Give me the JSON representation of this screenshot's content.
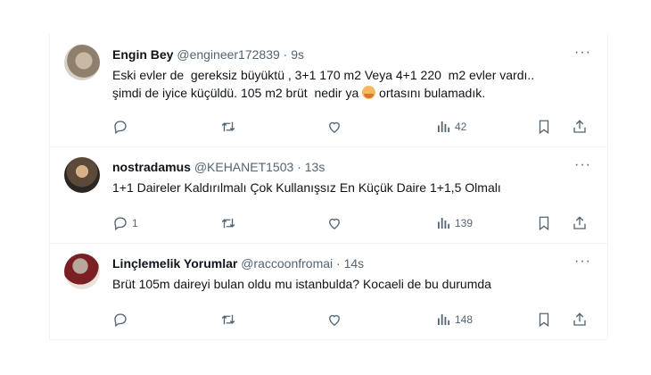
{
  "tweets": [
    {
      "name": "Engin Bey",
      "handle": "@engineer172839",
      "separator": "·",
      "time": "9s",
      "text_part1": "Eski evler de  gereksiz büyüktü , 3+1 170 m2 Veya 4+1 220  m2 evler vardı..\nşimdi de iyice küçüldü. 105 m2 brüt  nedir ya ",
      "text_part2": " ortasını bulamadık.",
      "emoji": "face-with-symbol-emoji",
      "replies": "",
      "views": "42"
    },
    {
      "name": "nostradamus",
      "handle": "@KEHANET1503",
      "separator": "·",
      "time": "13s",
      "text_part1": "1+1 Daireler Kaldırılmalı Çok Kullanışsız En Küçük Daire 1+1,5 Olmalı",
      "replies": "1",
      "views": "139"
    },
    {
      "name": "Linçlemelik Yorumlar",
      "handle": "@raccoonfromai",
      "separator": "·",
      "time": "14s",
      "text_part1": "Brüt 105m daireyi bulan oldu mu istanbulda? Kocaeli de bu durumda",
      "replies": "",
      "views": "148"
    }
  ],
  "more_label": "···",
  "icons": [
    "reply-icon",
    "retweet-icon",
    "like-icon",
    "views-icon",
    "bookmark-icon",
    "share-icon",
    "more-icon"
  ],
  "colors": {
    "text": "#0f1419",
    "secondary": "#536471",
    "border": "#eff3f4"
  }
}
